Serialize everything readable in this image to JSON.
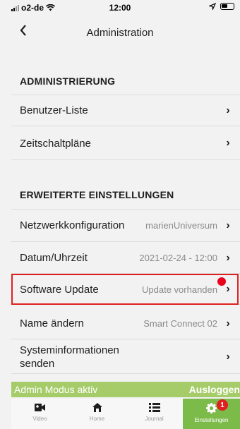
{
  "status_bar": {
    "carrier": "o2-de",
    "time": "12:00"
  },
  "nav": {
    "back_icon": "chevron-left-icon",
    "title": "Administration"
  },
  "sections": [
    {
      "header": "ADMINISTRIERUNG",
      "items": [
        {
          "label": "Benutzer-Liste",
          "value": ""
        },
        {
          "label": "Zeitschaltpläne",
          "value": ""
        }
      ]
    },
    {
      "header": "ERWEITERTE EINSTELLUNGEN",
      "items": [
        {
          "label": "Netzwerkkonfiguration",
          "value": "marienUniversum"
        },
        {
          "label": "Datum/Uhrzeit",
          "value": "2021-02-24 - 12:00"
        },
        {
          "label": "Software Update",
          "value": "Update vorhanden"
        },
        {
          "label": "Name ändern",
          "value": "Smart Connect 02"
        },
        {
          "label": "Systeminformationen senden",
          "value": ""
        }
      ]
    }
  ],
  "admin_banner": {
    "text": "Admin Modus aktiv",
    "logout": "Ausloggen"
  },
  "tabs": [
    {
      "label": "Video",
      "icon": "video-camera-icon"
    },
    {
      "label": "Home",
      "icon": "home-icon"
    },
    {
      "label": "Journal",
      "icon": "list-icon"
    },
    {
      "label": "Einstellungen",
      "icon": "gear-icon",
      "badge": "1",
      "active": true
    }
  ],
  "colors": {
    "accent_green": "#7cbb4a",
    "banner_green": "#a6cc6a",
    "alert_red": "#e02020"
  }
}
